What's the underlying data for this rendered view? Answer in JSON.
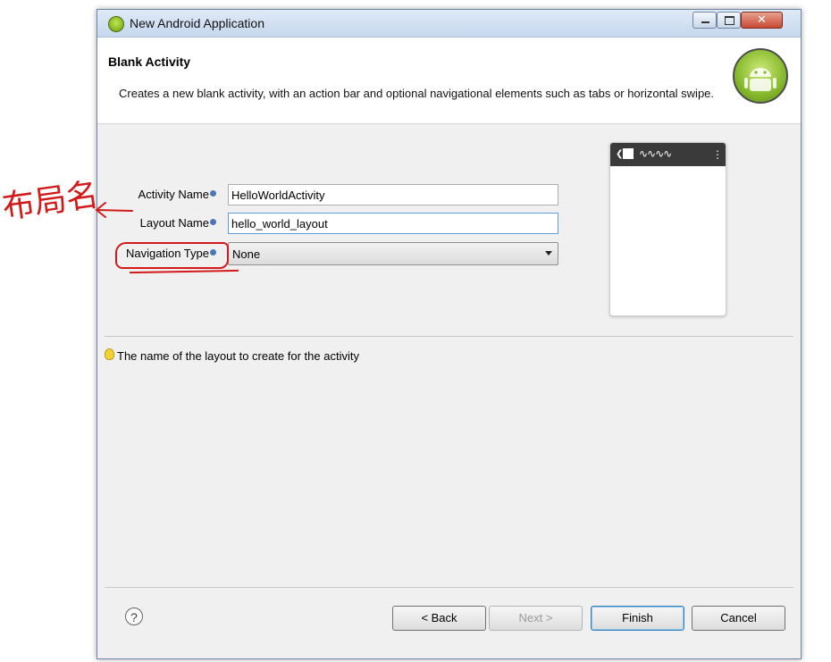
{
  "window": {
    "title": "New Android Application"
  },
  "header": {
    "title": "Blank Activity",
    "description": "Creates a new blank activity, with an action bar and optional navigational elements such as tabs or horizontal swipe."
  },
  "form": {
    "activity_name": {
      "label": "Activity Name",
      "value": "HelloWorldActivity"
    },
    "layout_name": {
      "label": "Layout Name",
      "value": "hello_world_layout"
    },
    "navigation_type": {
      "label": "Navigation Type",
      "value": "None"
    }
  },
  "hint": "The name of the layout to create for the activity",
  "buttons": {
    "help": "?",
    "back": "< Back",
    "next": "Next >",
    "finish": "Finish",
    "cancel": "Cancel"
  },
  "annotation": {
    "text": "布局名"
  }
}
